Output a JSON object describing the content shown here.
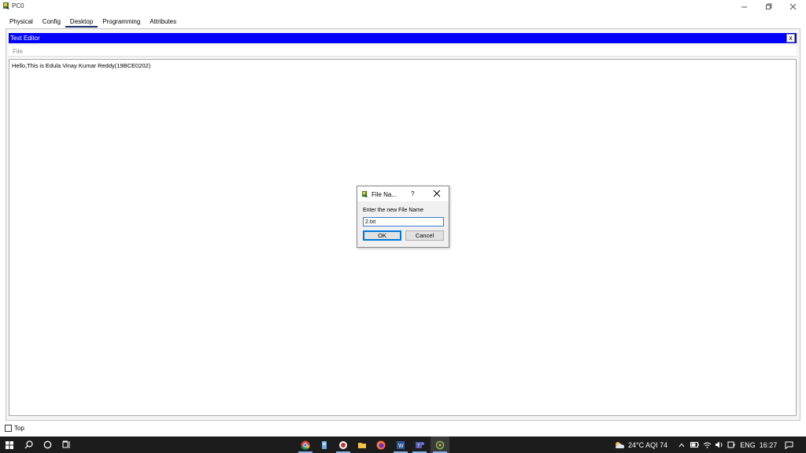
{
  "window": {
    "title": "PC0",
    "controls": [
      "minimize",
      "restore",
      "close"
    ]
  },
  "tabs": [
    {
      "label": "Physical",
      "active": false
    },
    {
      "label": "Config",
      "active": false
    },
    {
      "label": "Desktop",
      "active": true
    },
    {
      "label": "Programming",
      "active": false
    },
    {
      "label": "Attributes",
      "active": false
    }
  ],
  "editor": {
    "title": "Text Editor",
    "close_label": "x",
    "menu_file": "File",
    "content": "Hello,This is Edula Vinay Kumar Reddy(19BCE0202)",
    "header_color": "#0000ff"
  },
  "dialog": {
    "title": "File Na...",
    "help_label": "?",
    "prompt": "Enter the new File Name",
    "input_value": "2.txt",
    "ok_label": "OK",
    "cancel_label": "Cancel"
  },
  "bottom": {
    "top_checkbox_label": "Top",
    "top_checked": false
  },
  "taskbar": {
    "weather": "24°C AQI 74",
    "language": "ENG",
    "time": "16:27",
    "pinned": [
      "chrome-icon",
      "files-icon",
      "record-icon",
      "folder-icon",
      "firefox-icon",
      "word-icon",
      "teams-icon",
      "packet-tracer-icon"
    ]
  }
}
